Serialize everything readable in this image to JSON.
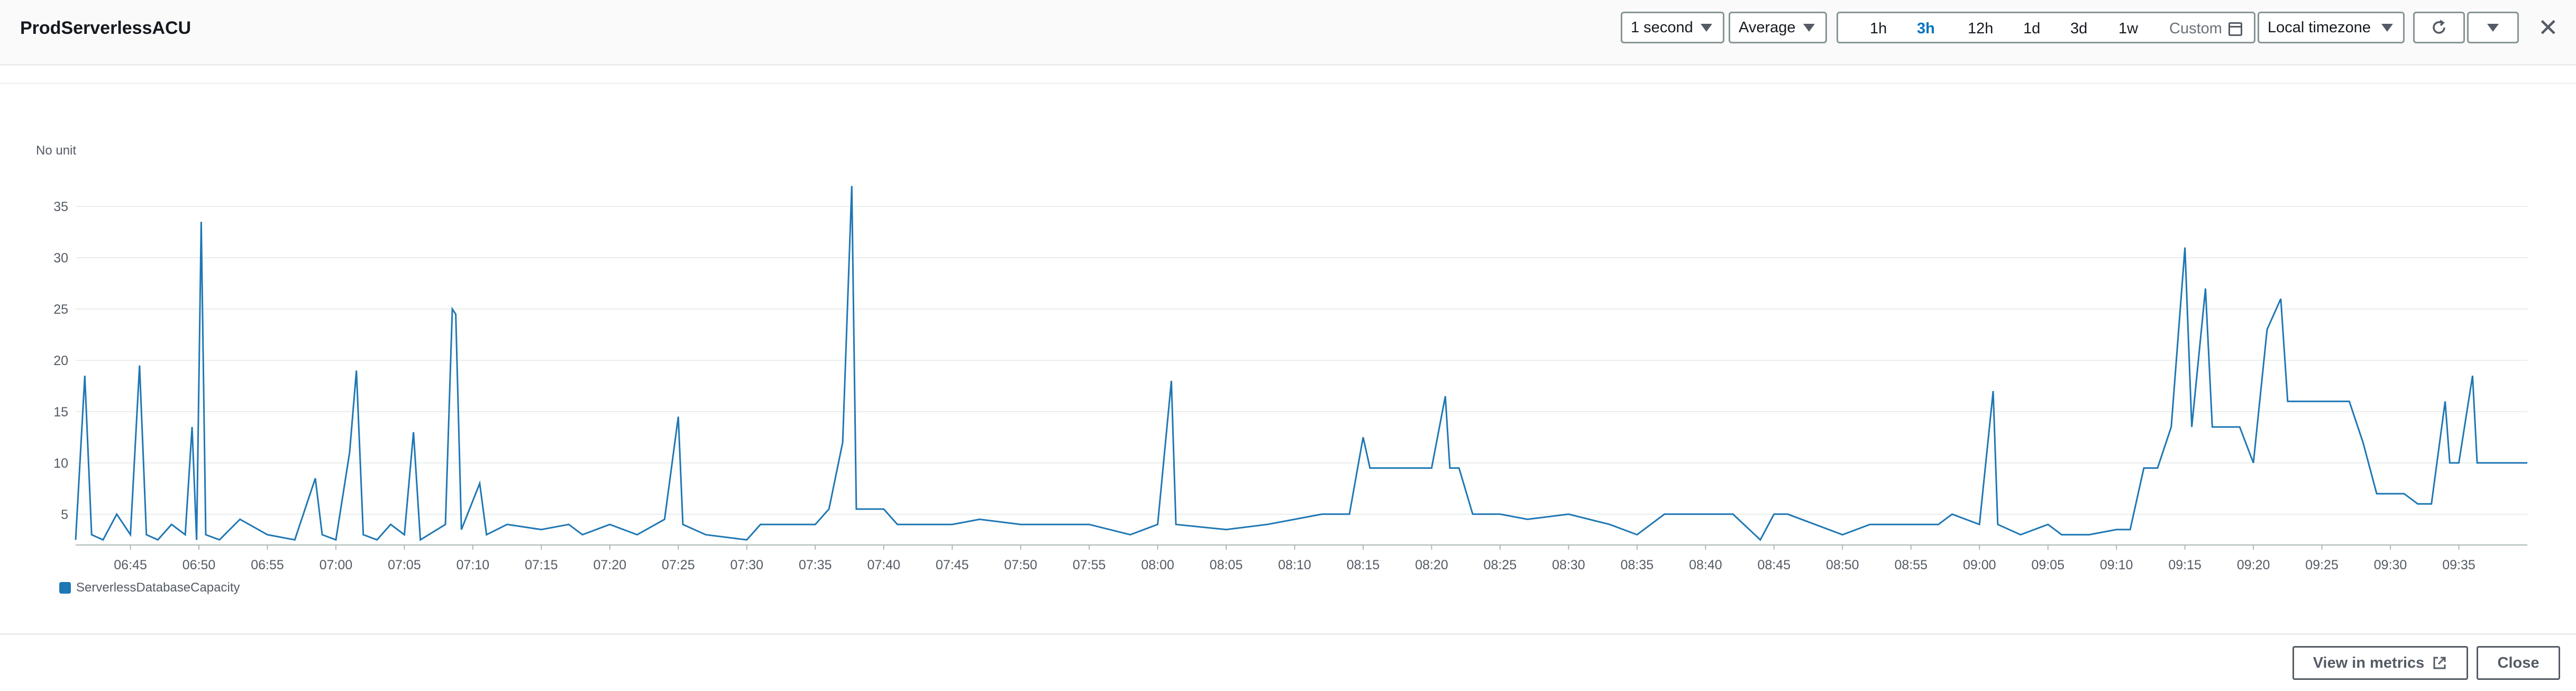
{
  "header": {
    "title": "ProdServerlessACU"
  },
  "controls": {
    "period": "1 second",
    "statistic": "Average",
    "ranges": [
      "1h",
      "3h",
      "12h",
      "1d",
      "3d",
      "1w"
    ],
    "active_range": "3h",
    "custom_label": "Custom",
    "timezone": "Local timezone",
    "refresh_icon": "refresh-icon",
    "menu_icon": "chevron-down-icon",
    "close_icon": "close-icon"
  },
  "footer": {
    "view_in_metrics": "View in metrics",
    "close": "Close"
  },
  "colors": {
    "series": "#1f77b4",
    "accent": "#0073bb"
  },
  "chart_data": {
    "type": "line",
    "unit_label": "No unit",
    "ylabel": "No unit",
    "xlabel": "",
    "grid": true,
    "legend_position": "bottom-left",
    "ylim": [
      2,
      38
    ],
    "yticks": [
      5,
      10,
      15,
      20,
      25,
      30,
      35
    ],
    "xlim": [
      "06:41",
      "09:40"
    ],
    "xticks": [
      "06:45",
      "06:50",
      "06:55",
      "07:00",
      "07:05",
      "07:10",
      "07:15",
      "07:20",
      "07:25",
      "07:30",
      "07:35",
      "07:40",
      "07:45",
      "07:50",
      "07:55",
      "08:00",
      "08:05",
      "08:10",
      "08:15",
      "08:20",
      "08:25",
      "08:30",
      "08:35",
      "08:40",
      "08:45",
      "08:50",
      "08:55",
      "09:00",
      "09:05",
      "09:10",
      "09:15",
      "09:20",
      "09:25",
      "09:30",
      "09:35"
    ],
    "series": [
      {
        "name": "ServerlessDatabaseCapacity",
        "color": "#1f77b4",
        "points": [
          [
            "06:41:00",
            2.5
          ],
          [
            "06:41:40",
            18.5
          ],
          [
            "06:42:10",
            3
          ],
          [
            "06:43:00",
            2.5
          ],
          [
            "06:44:00",
            5
          ],
          [
            "06:45:00",
            3
          ],
          [
            "06:45:40",
            19.5
          ],
          [
            "06:46:10",
            3
          ],
          [
            "06:47:00",
            2.5
          ],
          [
            "06:48:00",
            4
          ],
          [
            "06:49:00",
            3
          ],
          [
            "06:49:30",
            13.5
          ],
          [
            "06:49:50",
            2.5
          ],
          [
            "06:50:10",
            33.5
          ],
          [
            "06:50:30",
            3
          ],
          [
            "06:51:30",
            2.5
          ],
          [
            "06:53:00",
            4.5
          ],
          [
            "06:55:00",
            3
          ],
          [
            "06:57:00",
            2.5
          ],
          [
            "06:58:30",
            8.5
          ],
          [
            "06:59:00",
            3
          ],
          [
            "07:00:00",
            2.5
          ],
          [
            "07:01:00",
            11
          ],
          [
            "07:01:30",
            19
          ],
          [
            "07:02:00",
            3
          ],
          [
            "07:03:00",
            2.5
          ],
          [
            "07:04:00",
            4
          ],
          [
            "07:05:00",
            3
          ],
          [
            "07:05:40",
            13
          ],
          [
            "07:06:10",
            2.5
          ],
          [
            "07:08:00",
            4
          ],
          [
            "07:08:30",
            25
          ],
          [
            "07:08:45",
            24.5
          ],
          [
            "07:09:10",
            3.5
          ],
          [
            "07:10:30",
            8
          ],
          [
            "07:11:00",
            3
          ],
          [
            "07:12:30",
            4
          ],
          [
            "07:15:00",
            3.5
          ],
          [
            "07:17:00",
            4
          ],
          [
            "07:18:00",
            3
          ],
          [
            "07:20:00",
            4
          ],
          [
            "07:22:00",
            3
          ],
          [
            "07:24:00",
            4.5
          ],
          [
            "07:25:00",
            14.5
          ],
          [
            "07:25:20",
            4
          ],
          [
            "07:27:00",
            3
          ],
          [
            "07:30:00",
            2.5
          ],
          [
            "07:31:00",
            4
          ],
          [
            "07:33:00",
            4
          ],
          [
            "07:35:00",
            4
          ],
          [
            "07:36:00",
            5.5
          ],
          [
            "07:37:00",
            12
          ],
          [
            "07:37:40",
            37
          ],
          [
            "07:38:00",
            5.5
          ],
          [
            "07:40:00",
            5.5
          ],
          [
            "07:41:00",
            4
          ],
          [
            "07:43:00",
            4
          ],
          [
            "07:45:00",
            4
          ],
          [
            "07:47:00",
            4.5
          ],
          [
            "07:50:00",
            4
          ],
          [
            "07:55:00",
            4
          ],
          [
            "07:58:00",
            3
          ],
          [
            "08:00:00",
            4
          ],
          [
            "08:01:00",
            18
          ],
          [
            "08:01:20",
            4
          ],
          [
            "08:05:00",
            3.5
          ],
          [
            "08:08:00",
            4
          ],
          [
            "08:12:00",
            5
          ],
          [
            "08:14:00",
            5
          ],
          [
            "08:15:00",
            12.5
          ],
          [
            "08:15:30",
            9.5
          ],
          [
            "08:18:00",
            9.5
          ],
          [
            "08:20:00",
            9.5
          ],
          [
            "08:21:00",
            16.5
          ],
          [
            "08:21:20",
            9.5
          ],
          [
            "08:22:00",
            9.5
          ],
          [
            "08:23:00",
            5
          ],
          [
            "08:25:00",
            5
          ],
          [
            "08:27:00",
            4.5
          ],
          [
            "08:30:00",
            5
          ],
          [
            "08:33:00",
            4
          ],
          [
            "08:35:00",
            3
          ],
          [
            "08:37:00",
            5
          ],
          [
            "08:40:00",
            5
          ],
          [
            "08:42:00",
            5
          ],
          [
            "08:44:00",
            2.5
          ],
          [
            "08:45:00",
            5
          ],
          [
            "08:46:00",
            5
          ],
          [
            "08:50:00",
            3
          ],
          [
            "08:52:00",
            4
          ],
          [
            "08:55:00",
            4
          ],
          [
            "08:57:00",
            4
          ],
          [
            "08:58:00",
            5
          ],
          [
            "09:00:00",
            4
          ],
          [
            "09:01:00",
            17
          ],
          [
            "09:01:20",
            4
          ],
          [
            "09:03:00",
            3
          ],
          [
            "09:05:00",
            4
          ],
          [
            "09:06:00",
            3
          ],
          [
            "09:08:00",
            3
          ],
          [
            "09:10:00",
            3.5
          ],
          [
            "09:11:00",
            3.5
          ],
          [
            "09:12:00",
            9.5
          ],
          [
            "09:13:00",
            9.5
          ],
          [
            "09:14:00",
            13.5
          ],
          [
            "09:15:00",
            31
          ],
          [
            "09:15:30",
            13.5
          ],
          [
            "09:16:30",
            27
          ],
          [
            "09:17:00",
            13.5
          ],
          [
            "09:18:00",
            13.5
          ],
          [
            "09:19:00",
            13.5
          ],
          [
            "09:20:00",
            10
          ],
          [
            "09:21:00",
            23
          ],
          [
            "09:22:00",
            26
          ],
          [
            "09:22:30",
            16
          ],
          [
            "09:24:00",
            16
          ],
          [
            "09:27:00",
            16
          ],
          [
            "09:28:00",
            12
          ],
          [
            "09:29:00",
            7
          ],
          [
            "09:31:00",
            7
          ],
          [
            "09:32:00",
            6
          ],
          [
            "09:33:00",
            6
          ],
          [
            "09:34:00",
            16
          ],
          [
            "09:34:20",
            10
          ],
          [
            "09:35:00",
            10
          ],
          [
            "09:36:00",
            18.5
          ],
          [
            "09:36:20",
            10
          ],
          [
            "09:40:00",
            10
          ]
        ]
      }
    ]
  }
}
